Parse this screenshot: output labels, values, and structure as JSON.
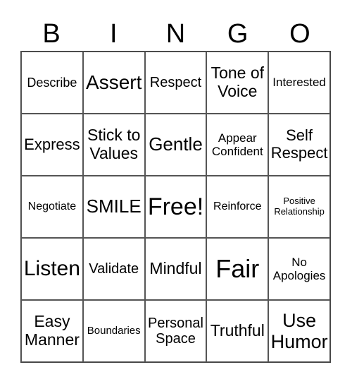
{
  "header": [
    "B",
    "I",
    "N",
    "G",
    "O"
  ],
  "cells": [
    "Describe",
    "Assert",
    "Respect",
    "Tone of Voice",
    "Interested",
    "Express",
    "Stick to Values",
    "Gentle",
    "Appear Confident",
    "Self Respect",
    "Negotiate",
    "SMILE",
    "Free!",
    "Reinforce",
    "Positive Relationship",
    "Listen",
    "Validate",
    "Mindful",
    "Fair",
    "No Apologies",
    "Easy Manner",
    "Boundaries",
    "Personal Space",
    "Truthful",
    "Use Humor"
  ]
}
